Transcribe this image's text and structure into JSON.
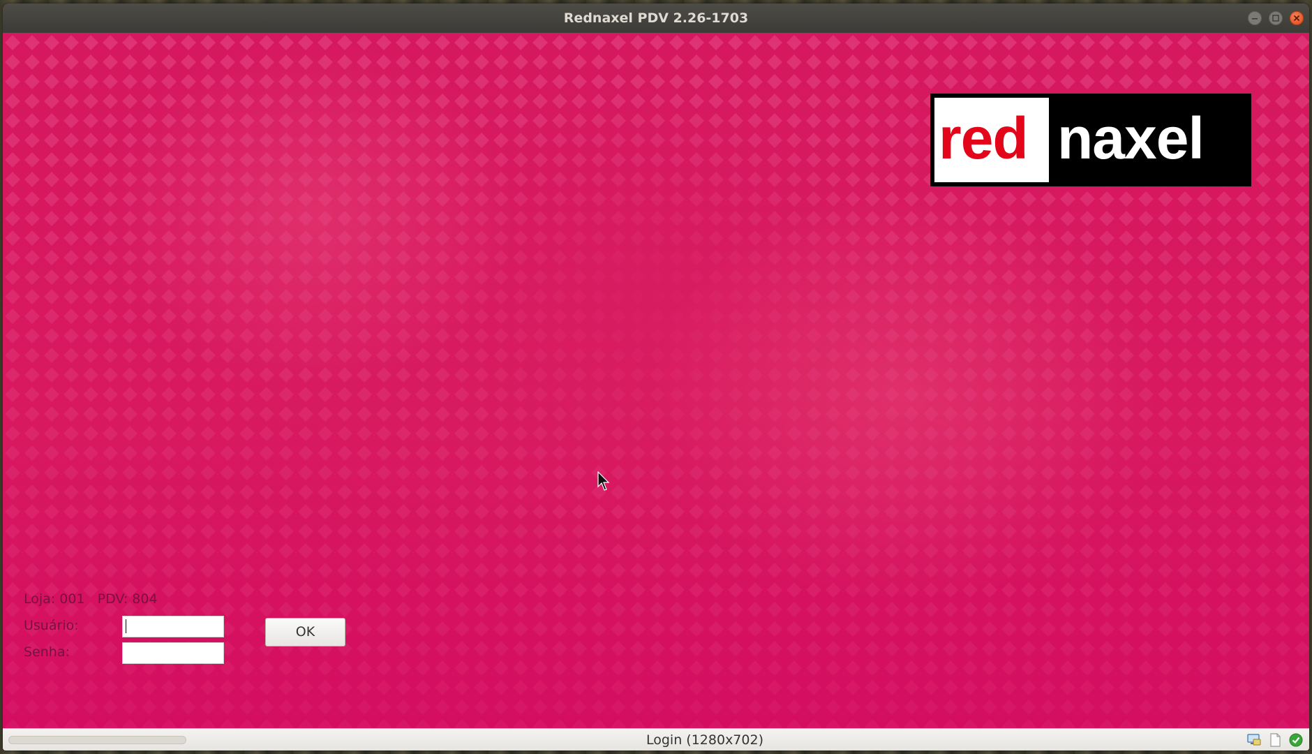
{
  "window": {
    "title": "Rednaxel PDV 2.26-1703"
  },
  "logo": {
    "part_red": "red",
    "part_white": "naxel",
    "colors": {
      "red": "#e3061b",
      "background": "#000000",
      "box": "#ffffff"
    }
  },
  "login": {
    "store_info": "Loja: 001   PDV: 804",
    "user_label": "Usuário:",
    "user_value": "",
    "password_label": "Senha:",
    "password_value": "",
    "ok_label": "OK"
  },
  "statusbar": {
    "text": "Login (1280x702)",
    "icons": [
      "monitor-icon",
      "document-icon",
      "check-ok-icon"
    ]
  },
  "theme": {
    "background": "#d6185f",
    "titlebar": "#3c3b37",
    "close_button": "#df4a16"
  }
}
